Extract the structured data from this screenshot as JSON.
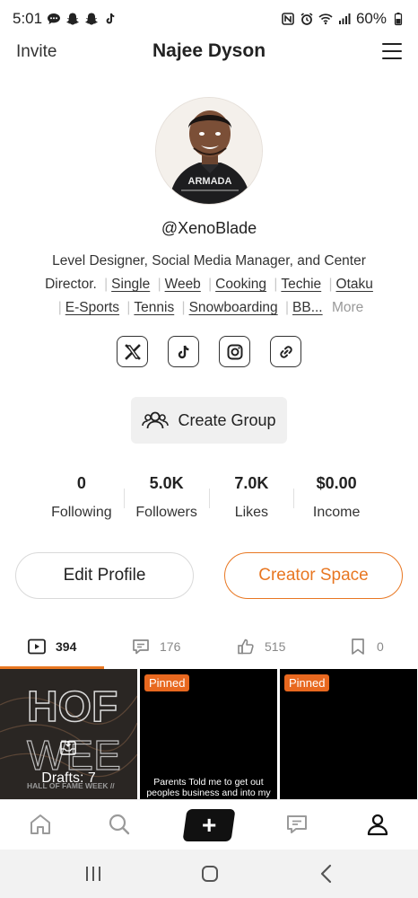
{
  "status_bar": {
    "time": "5:01",
    "battery": "60%"
  },
  "header": {
    "invite_label": "Invite",
    "title": "Najee Dyson"
  },
  "profile": {
    "handle": "@XenoBlade",
    "bio_text": "Level Designer, Social Media Manager, and Center Director.",
    "tags": [
      "Single",
      "Weeb",
      "Cooking",
      "Techie",
      "Otaku",
      "E-Sports",
      "Tennis",
      "Snowboarding",
      "BB..."
    ],
    "more_label": "More",
    "shirt_text": "ARMADA"
  },
  "socials": [
    "x-icon",
    "tiktok-icon",
    "instagram-icon",
    "link-icon"
  ],
  "create_group_label": "Create Group",
  "stats": [
    {
      "value": "0",
      "label": "Following"
    },
    {
      "value": "5.0K",
      "label": "Followers"
    },
    {
      "value": "7.0K",
      "label": "Likes"
    },
    {
      "value": "$0.00",
      "label": "Income"
    }
  ],
  "buttons": {
    "edit_profile": "Edit Profile",
    "creator_space": "Creator Space"
  },
  "tabs": [
    {
      "icon": "video-icon",
      "count": "394"
    },
    {
      "icon": "comment-icon",
      "count": "176"
    },
    {
      "icon": "thumbs-up-icon",
      "count": "515"
    },
    {
      "icon": "bookmark-icon",
      "count": "0"
    }
  ],
  "grid": {
    "drafts_label": "Drafts: 7",
    "draft_art_text": "HALL OF FAME WEEK //",
    "pinned_label": "Pinned",
    "cell2_caption": "Parents Told me to get out peoples business and into my"
  },
  "colors": {
    "accent": "#e87722",
    "pinned": "#e8681f"
  }
}
